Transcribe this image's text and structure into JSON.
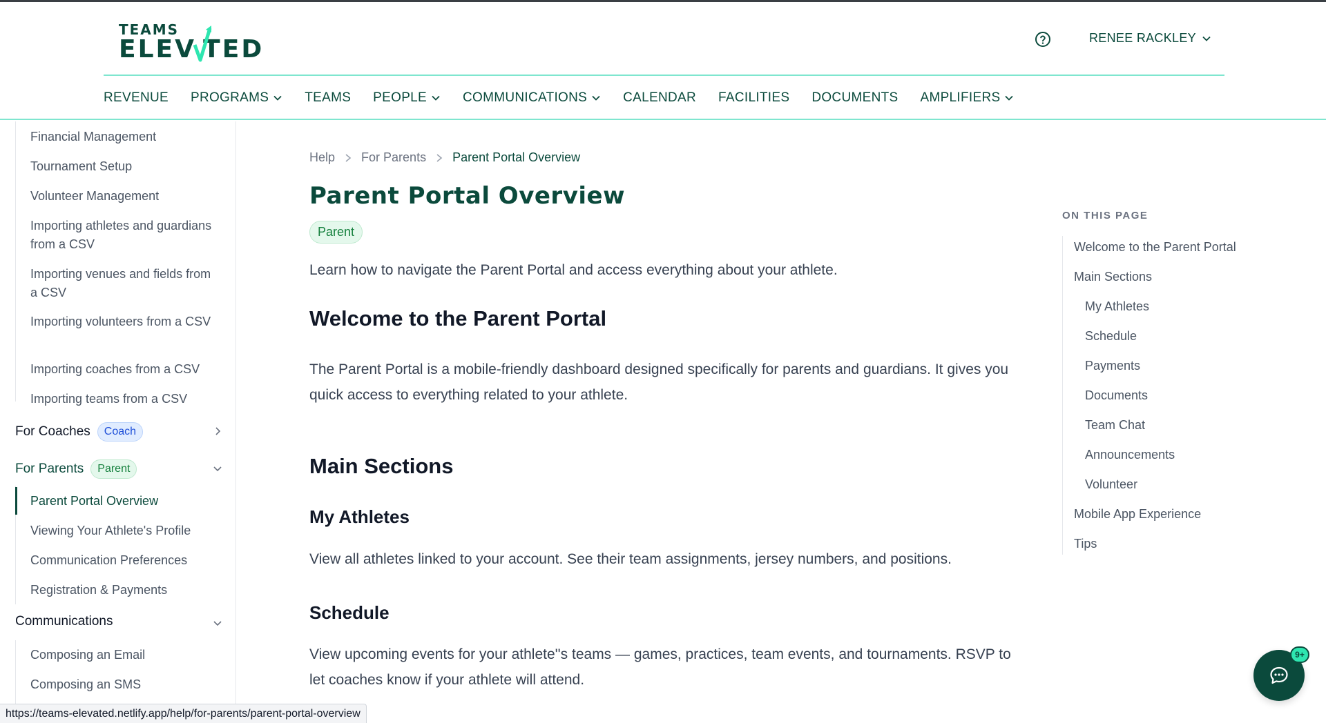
{
  "header": {
    "logo_top": "TEAMS",
    "logo_bottom": "ELEV TED",
    "user_name": "RENEE RACKLEY"
  },
  "nav": [
    {
      "label": "REVENUE",
      "dropdown": false
    },
    {
      "label": "PROGRAMS",
      "dropdown": true
    },
    {
      "label": "TEAMS",
      "dropdown": false
    },
    {
      "label": "PEOPLE",
      "dropdown": true
    },
    {
      "label": "COMMUNICATIONS",
      "dropdown": true
    },
    {
      "label": "CALENDAR",
      "dropdown": false
    },
    {
      "label": "FACILITIES",
      "dropdown": false
    },
    {
      "label": "DOCUMENTS",
      "dropdown": false
    },
    {
      "label": "AMPLIFIERS",
      "dropdown": true
    }
  ],
  "sidebar": {
    "admin_links": [
      "Financial Management",
      "Tournament Setup",
      "Volunteer Management",
      "Importing athletes and guardians from a CSV",
      "Importing venues and fields from a CSV",
      "Importing volunteers from a CSV",
      "Importing coaches from a CSV",
      "Importing teams from a CSV"
    ],
    "coaches": {
      "label": "For Coaches",
      "badge": "Coach"
    },
    "parents": {
      "label": "For Parents",
      "badge": "Parent"
    },
    "parent_links": [
      "Parent Portal Overview",
      "Viewing Your Athlete's Profile",
      "Communication Preferences",
      "Registration & Payments"
    ],
    "communications": {
      "label": "Communications"
    },
    "communication_links": [
      "Composing an Email",
      "Composing an SMS"
    ]
  },
  "main": {
    "breadcrumbs": [
      "Help",
      "For Parents",
      "Parent Portal Overview"
    ],
    "title": "Parent Portal Overview",
    "badge": "Parent",
    "lead": "Learn how to navigate the Parent Portal and access everything about your athlete.",
    "welcome_heading": "Welcome to the Parent Portal",
    "welcome_text": "The Parent Portal is a mobile-friendly dashboard designed specifically for parents and guardians. It gives you quick access to everything related to your athlete.",
    "main_sections_heading": "Main Sections",
    "my_athletes_heading": "My Athletes",
    "my_athletes_text": "View all athletes linked to your account. See their team assignments, jersey numbers, and positions.",
    "schedule_heading": "Schedule",
    "schedule_text": "View upcoming events for your athlete''s teams — games, practices, team events, and tournaments. RSVP to let coaches know if your athlete will attend."
  },
  "toc": {
    "title": "ON THIS PAGE",
    "items": [
      {
        "label": "Welcome to the Parent Portal",
        "level": 1
      },
      {
        "label": "Main Sections",
        "level": 1
      },
      {
        "label": "My Athletes",
        "level": 2
      },
      {
        "label": "Schedule",
        "level": 2
      },
      {
        "label": "Payments",
        "level": 2
      },
      {
        "label": "Documents",
        "level": 2
      },
      {
        "label": "Team Chat",
        "level": 2
      },
      {
        "label": "Announcements",
        "level": 2
      },
      {
        "label": "Volunteer",
        "level": 2
      },
      {
        "label": "Mobile App Experience",
        "level": 1
      },
      {
        "label": "Tips",
        "level": 1
      }
    ]
  },
  "statusbar": {
    "url": "https://teams-elevated.netlify.app/help/for-parents/parent-portal-overview"
  },
  "chat": {
    "badge": "9+"
  },
  "colors": {
    "brand": "#0b4a3c",
    "accent": "#2ee6b0",
    "divider": "#7fe6cf"
  }
}
